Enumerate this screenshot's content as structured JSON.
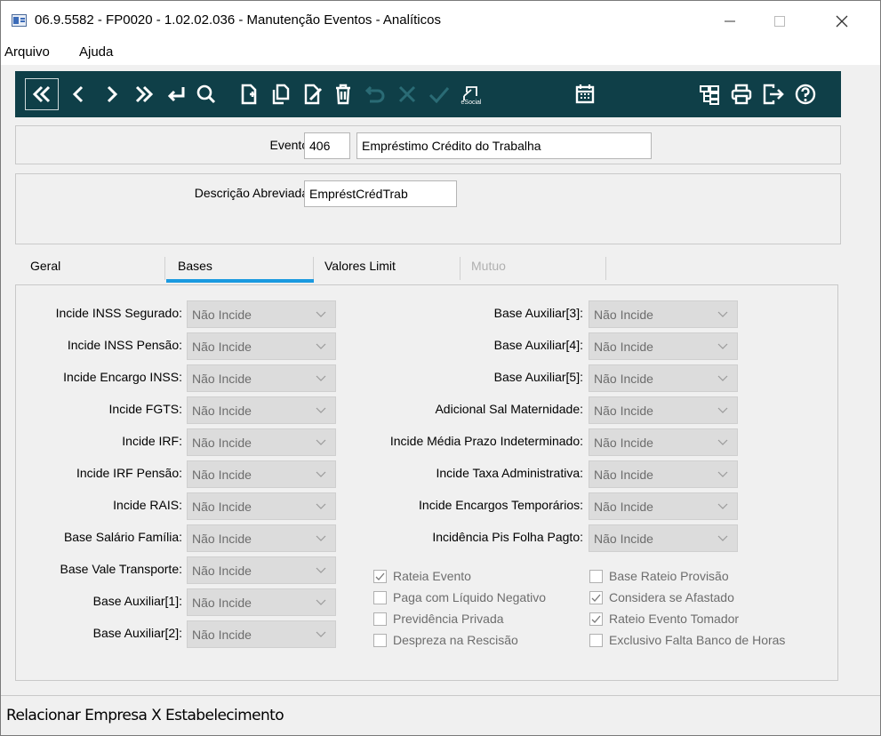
{
  "window": {
    "title": "06.9.5582 - FP0020 - 1.02.02.036 - Manutenção Eventos - Analíticos"
  },
  "menu": {
    "items": [
      "Arquivo",
      "Ajuda"
    ]
  },
  "toolbar": {
    "icons": [
      "first-record-icon",
      "previous-icon",
      "next-icon",
      "last-record-icon",
      "return-icon",
      "search-icon",
      "new-document-icon",
      "copy-document-icon",
      "edit-document-icon",
      "delete-icon",
      "undo-icon",
      "cancel-icon",
      "confirm-icon",
      "esocial-icon",
      "calendar-icon",
      "structure-icon",
      "print-icon",
      "exit-icon",
      "help-icon"
    ],
    "esocial_label": "eSocial",
    "bg_color": "#0f3f48"
  },
  "header": {
    "evento_label": "Evento:",
    "evento_code": "406",
    "evento_name": "Empréstimo Crédito do Trabalha",
    "descricao_label": "Descrição Abreviada:",
    "descricao_value": "EmpréstCrédTrab"
  },
  "tabs": [
    {
      "label": "Geral",
      "state": "normal"
    },
    {
      "label": "Bases",
      "state": "active"
    },
    {
      "label": "Valores Limit",
      "state": "normal"
    },
    {
      "label": "Mutuo",
      "state": "disabled"
    }
  ],
  "bases": {
    "left_fields": [
      {
        "label": "Incide INSS Segurado:",
        "value": "Não Incide"
      },
      {
        "label": "Incide INSS Pensão:",
        "value": "Não Incide"
      },
      {
        "label": "Incide Encargo INSS:",
        "value": "Não Incide"
      },
      {
        "label": "Incide FGTS:",
        "value": "Não Incide"
      },
      {
        "label": "Incide IRF:",
        "value": "Não Incide"
      },
      {
        "label": "Incide IRF Pensão:",
        "value": "Não Incide"
      },
      {
        "label": "Incide RAIS:",
        "value": "Não Incide"
      },
      {
        "label": "Base Salário Família:",
        "value": "Não Incide"
      },
      {
        "label": "Base Vale Transporte:",
        "value": "Não Incide"
      },
      {
        "label": "Base Auxiliar[1]:",
        "value": "Não Incide"
      },
      {
        "label": "Base Auxiliar[2]:",
        "value": "Não Incide"
      }
    ],
    "right_fields": [
      {
        "label": "Base Auxiliar[3]:",
        "value": "Não Incide"
      },
      {
        "label": "Base Auxiliar[4]:",
        "value": "Não Incide"
      },
      {
        "label": "Base Auxiliar[5]:",
        "value": "Não Incide"
      },
      {
        "label": "Adicional Sal Maternidade:",
        "value": "Não Incide"
      },
      {
        "label": "Incide Média Prazo Indeterminado:",
        "value": "Não Incide"
      },
      {
        "label": "Incide Taxa Administrativa:",
        "value": "Não Incide"
      },
      {
        "label": "Incide Encargos Temporários:",
        "value": "Não Incide"
      },
      {
        "label": "Incidência Pis Folha Pagto:",
        "value": "Não Incide"
      }
    ],
    "checks_left": [
      {
        "label": "Rateia Evento",
        "checked": true
      },
      {
        "label": "Paga com Líquido Negativo",
        "checked": false
      },
      {
        "label": "Previdência Privada",
        "checked": false
      },
      {
        "label": "Despreza na Rescisão",
        "checked": false
      }
    ],
    "checks_right": [
      {
        "label": "Base Rateio Provisão",
        "checked": false
      },
      {
        "label": "Considera se Afastado",
        "checked": true
      },
      {
        "label": "Rateio Evento Tomador",
        "checked": true
      },
      {
        "label": "Exclusivo Falta Banco de Horas",
        "checked": false
      }
    ]
  },
  "status": {
    "text": "Relacionar Empresa X Estabelecimento"
  }
}
